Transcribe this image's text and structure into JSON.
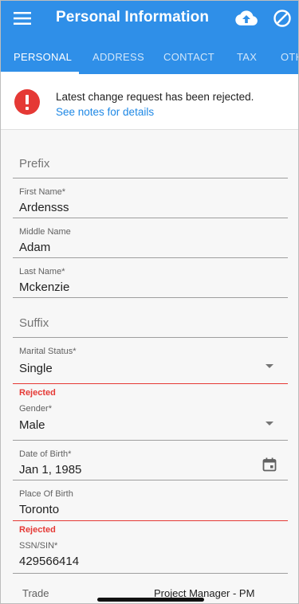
{
  "header": {
    "title": "Personal Information",
    "menu_icon": "menu-icon",
    "upload_icon": "cloud-upload-icon",
    "cancel_icon": "block-icon"
  },
  "tabs": [
    {
      "label": "PERSONAL",
      "active": true
    },
    {
      "label": "ADDRESS",
      "active": false
    },
    {
      "label": "CONTACT",
      "active": false
    },
    {
      "label": "TAX",
      "active": false
    },
    {
      "label": "OTH",
      "active": false
    }
  ],
  "alert": {
    "message": "Latest change request has been rejected.",
    "link": "See notes for details"
  },
  "form": {
    "prefix": {
      "placeholder": "Prefix"
    },
    "first_name": {
      "label": "First Name*",
      "value": "Ardensss"
    },
    "middle_name": {
      "label": "Middle Name",
      "value": "Adam"
    },
    "last_name": {
      "label": "Last Name*",
      "value": "Mckenzie"
    },
    "suffix": {
      "placeholder": "Suffix"
    },
    "marital_status": {
      "label": "Marital Status*",
      "value": "Single",
      "status": "Rejected"
    },
    "gender": {
      "label": "Gender*",
      "value": "Male"
    },
    "date_of_birth": {
      "label": "Date of Birth*",
      "value": "Jan 1, 1985"
    },
    "place_of_birth": {
      "label": "Place Of Birth",
      "value": "Toronto",
      "status": "Rejected"
    },
    "ssn": {
      "label": "SSN/SIN*",
      "value": "429566414"
    },
    "trade": {
      "label": "Trade",
      "value": "Project Manager - PM"
    }
  },
  "colors": {
    "primary": "#2f8fe8",
    "error": "#e53935",
    "link": "#1e88e5"
  }
}
